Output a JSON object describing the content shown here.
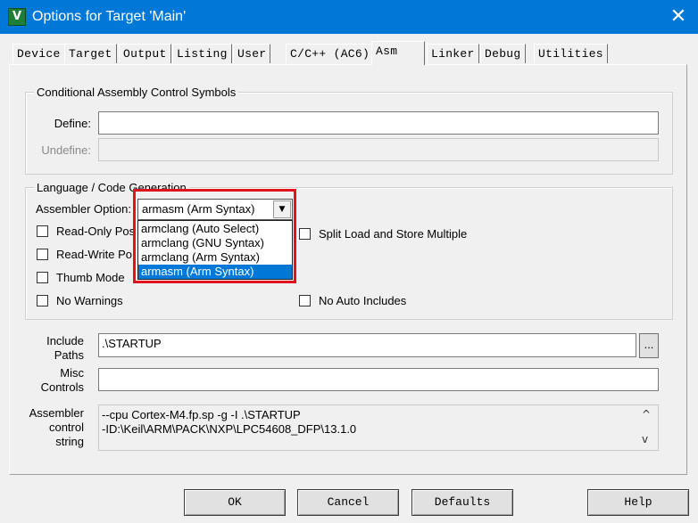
{
  "window": {
    "title": "Options for Target 'Main'",
    "app_icon_glyph": "V"
  },
  "tabs": [
    {
      "label": "Device"
    },
    {
      "label": "Target"
    },
    {
      "label": "Output"
    },
    {
      "label": "Listing"
    },
    {
      "label": "User"
    },
    {
      "label": "C/C++ (AC6)"
    },
    {
      "label": "Asm",
      "active": true
    },
    {
      "label": "Linker"
    },
    {
      "label": "Debug"
    },
    {
      "label": "Utilities"
    }
  ],
  "conditional": {
    "legend": "Conditional Assembly Control Symbols",
    "define_label": "Define:",
    "define_value": "",
    "undefine_label": "Undefine:",
    "undefine_value": ""
  },
  "language": {
    "legend": "Language / Code Generation",
    "assembler_option_label": "Assembler Option:",
    "assembler_option_value": "armasm (Arm Syntax)",
    "options": [
      "armclang (Auto Select)",
      "armclang (GNU Syntax)",
      "armclang (Arm Syntax)",
      "armasm (Arm Syntax)"
    ],
    "selected_index": 3,
    "read_only_label": "Read-Only Pos",
    "read_write_label": "Read-Write Po",
    "thumb_mode_label": "Thumb Mode",
    "no_warnings_label": "No Warnings",
    "split_load_label": "Split Load and Store Multiple",
    "no_auto_includes_label": "No Auto Includes"
  },
  "paths": {
    "include_label_1": "Include",
    "include_label_2": "Paths",
    "include_value": ".\\STARTUP",
    "browse_label": "...",
    "misc_label_1": "Misc",
    "misc_label_2": "Controls",
    "misc_value": ""
  },
  "control_string": {
    "label_1": "Assembler",
    "label_2": "control",
    "label_3": "string",
    "line1": "--cpu Cortex-M4.fp.sp -g -I .\\STARTUP",
    "line2": "-ID:\\Keil\\ARM\\PACK\\NXP\\LPC54608_DFP\\13.1.0"
  },
  "buttons": {
    "ok": "OK",
    "cancel": "Cancel",
    "defaults": "Defaults",
    "help": "Help"
  },
  "colors": {
    "titlebar": "#0078d7",
    "selection": "#0078d7",
    "highlight_box": "#e0141e"
  }
}
